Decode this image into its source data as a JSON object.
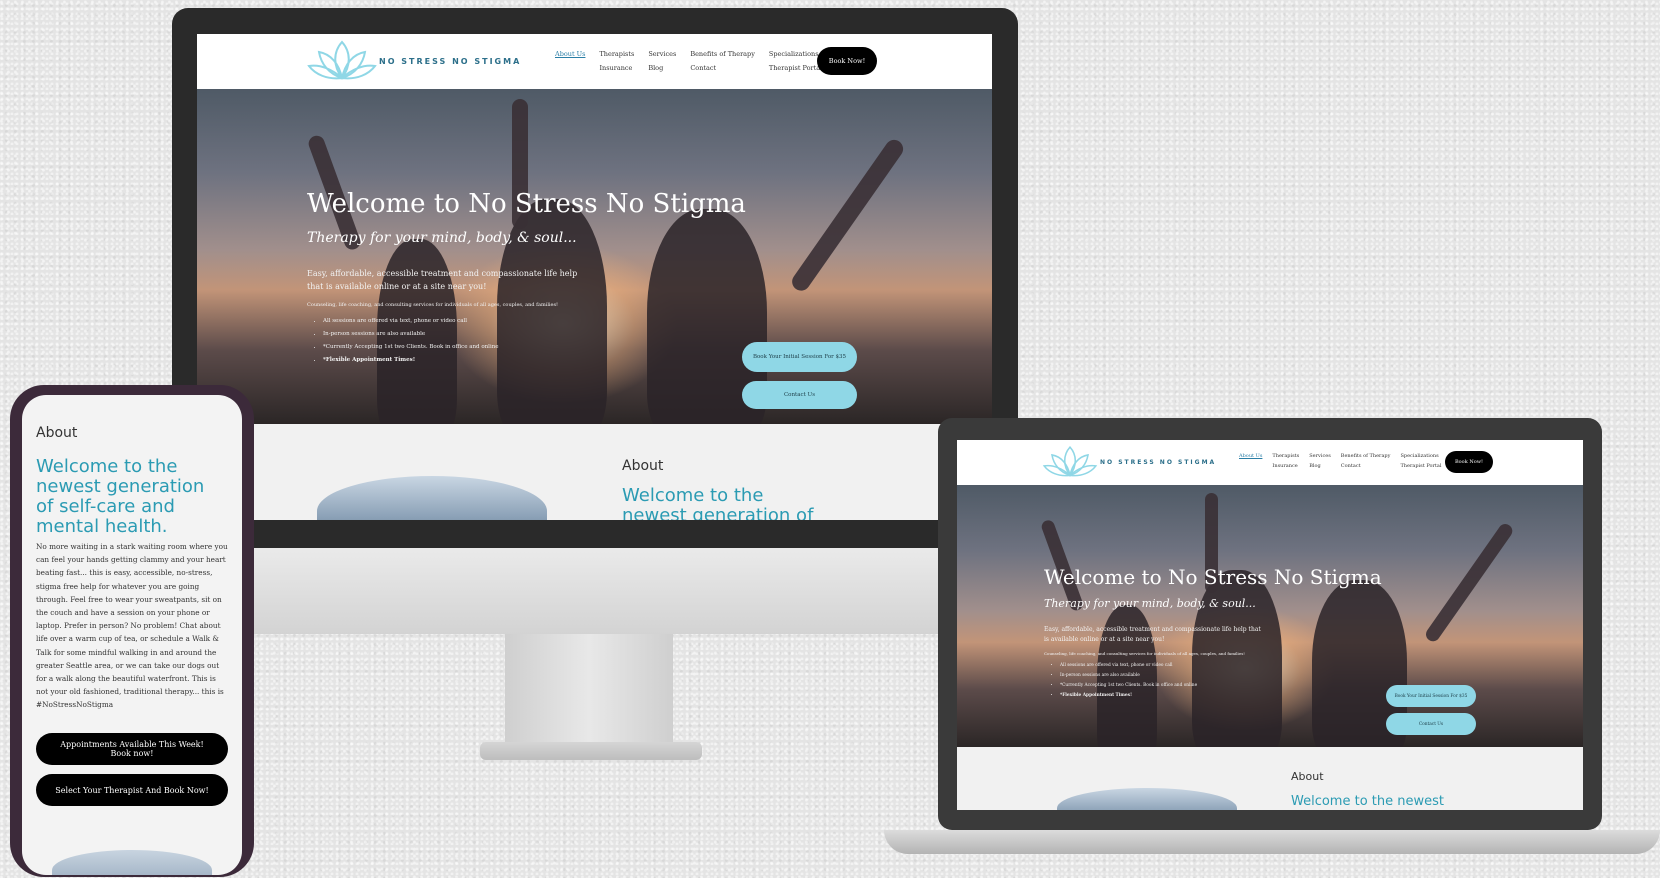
{
  "site": {
    "brand": "NO STRESS NO STIGMA",
    "nav_items": [
      "About Us",
      "Therapists",
      "Services",
      "Benefits of Therapy",
      "Specializations",
      "Insurance",
      "Blog",
      "Contact",
      "Therapist Portal"
    ],
    "book_now": "Book Now!",
    "hero_title": "Welcome to No Stress No Stigma",
    "hero_subtitle": "Therapy for your mind, body, & soul...",
    "hero_text": "Easy, affordable, accessible treatment and compassionate life help that is available online or at a site near you!",
    "hero_small": "Counseling, life coaching, and consulting services for individuals of all ages, couples, and families!",
    "hero_bullets": [
      "All sessions are offered via text, phone or video call",
      "In-person sessions are also available",
      "*Currently Accepting 1st two Clients. Book in office and online",
      "*Flexible Appointment Times!"
    ],
    "cta_book": "Book Your Initial Session For $35",
    "cta_contact": "Contact Us",
    "about_heading": "About",
    "about_welcome": "Welcome to the newest generation of self-care and mental health.",
    "about_body": "No more waiting in a stark waiting room where you can feel your hands getting clammy and your heart beating fast... this is easy, accessible, no-stress, stigma free help for whatever you are going through. Feel free to wear your sweatpants, sit on the couch and have a session on your phone or laptop. Prefer in person? No problem! Chat about life over a warm cup of tea, or schedule a Walk & Talk for some mindful walking in and around the greater Seattle area, or we can take our dogs out for a walk along the beautiful waterfront. This is not your old fashioned, traditional therapy... this is #NoStressNoStigma",
    "phone_btn_1": "Appointments Available This Week! Book now!",
    "phone_btn_2": "Select Your Therapist And Book Now!"
  },
  "colors": {
    "accent": "#2b9bb3",
    "cta": "#8fd7e6",
    "button_dark": "#000000",
    "logo": "#8fd7e6"
  },
  "icons": [
    "lotus-logo-icon"
  ]
}
